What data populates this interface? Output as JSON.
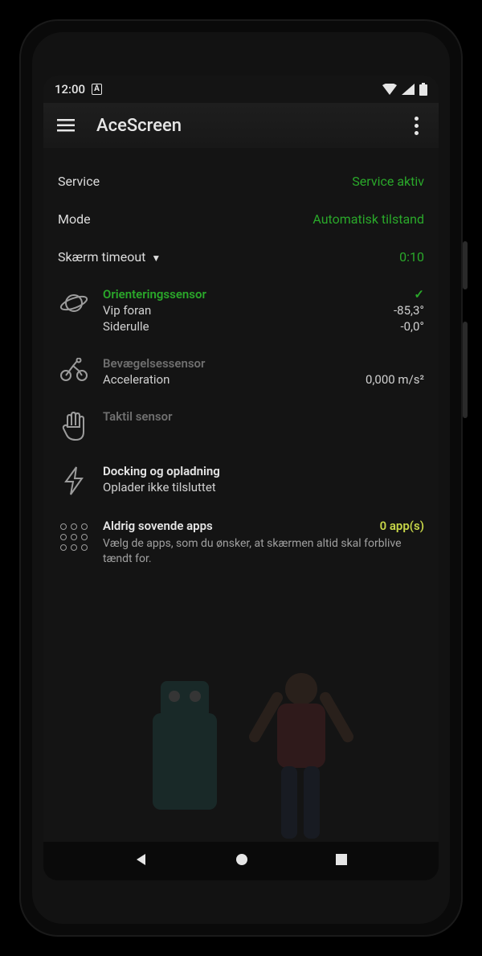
{
  "status": {
    "time": "12:00",
    "lang_badge": "A"
  },
  "app": {
    "title": "AceScreen"
  },
  "rows": {
    "service": {
      "label": "Service",
      "value": "Service aktiv"
    },
    "mode": {
      "label": "Mode",
      "value": "Automatisk tilstand"
    },
    "timeout": {
      "label": "Skærm timeout",
      "value": "0:10"
    }
  },
  "orientation": {
    "title": "Orienteringssensor",
    "check": "✓",
    "pitch": {
      "label": "Vip foran",
      "value": "-85,3°"
    },
    "roll": {
      "label": "Siderulle",
      "value": "-0,0°"
    }
  },
  "motion": {
    "title": "Bevægelsessensor",
    "accel": {
      "label": "Acceleration",
      "value": "0,000 m/s²"
    }
  },
  "tactile": {
    "title": "Taktil sensor"
  },
  "docking": {
    "title": "Docking og opladning",
    "sub": "Oplader ikke tilsluttet"
  },
  "apps": {
    "title": "Aldrig sovende apps",
    "count": "0 app(s)",
    "sub": "Vælg de apps, som du ønsker, at skærmen altid skal forblive tændt for."
  }
}
